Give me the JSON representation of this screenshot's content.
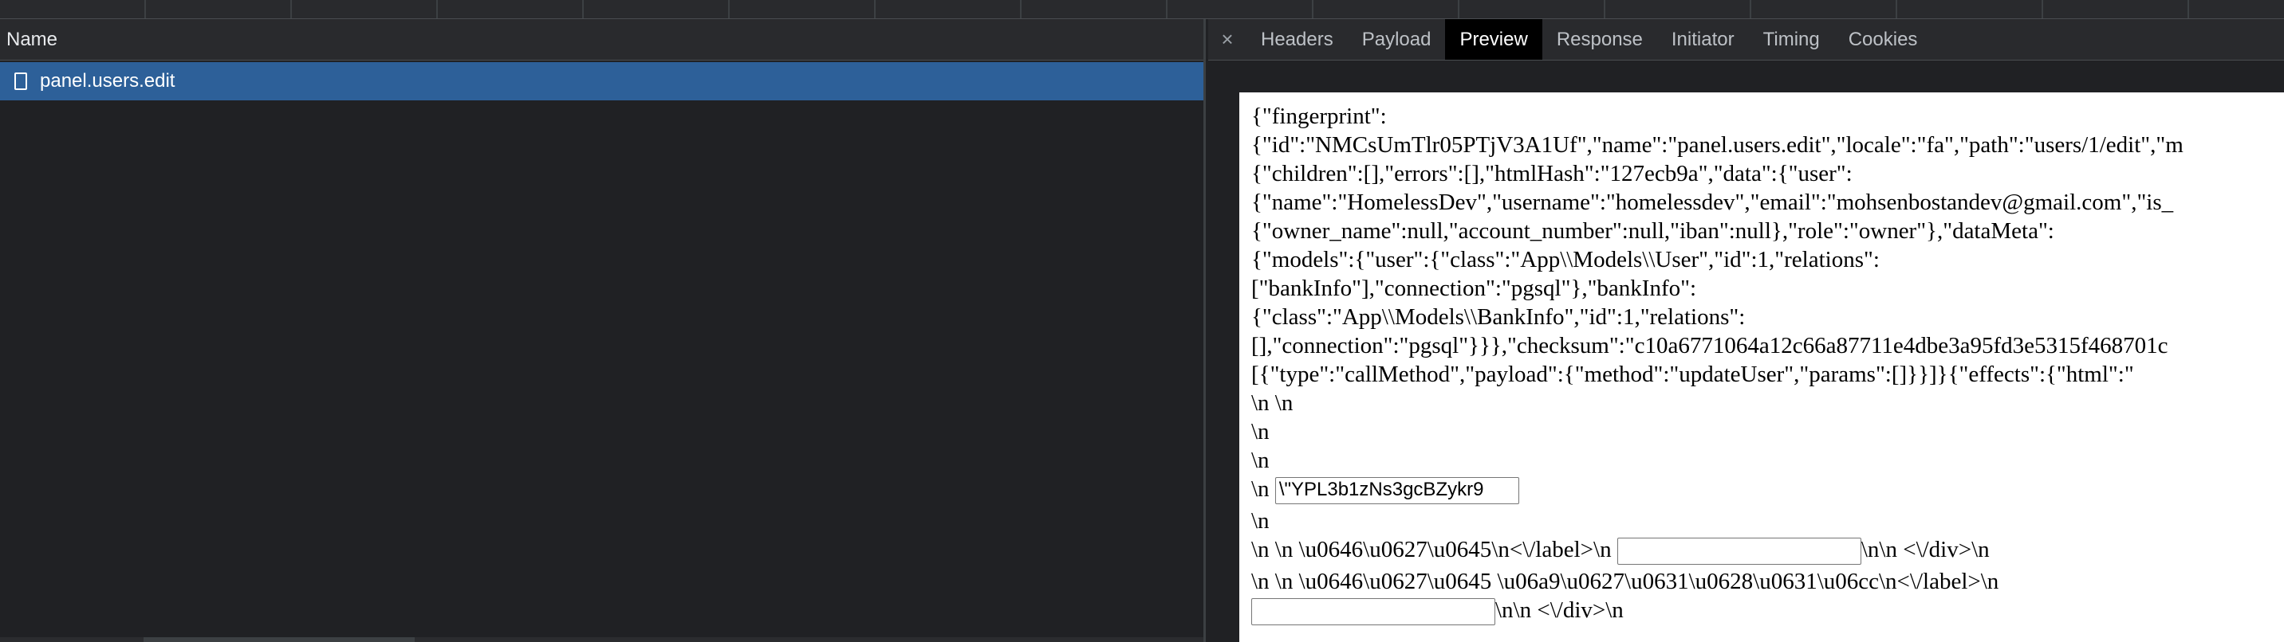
{
  "network": {
    "column_name": "Name",
    "requests": [
      {
        "name": "panel.users.edit",
        "selected": true
      }
    ]
  },
  "details": {
    "tabs": [
      {
        "label": "Headers",
        "active": false
      },
      {
        "label": "Payload",
        "active": false
      },
      {
        "label": "Preview",
        "active": true
      },
      {
        "label": "Response",
        "active": false
      },
      {
        "label": "Initiator",
        "active": false
      },
      {
        "label": "Timing",
        "active": false
      },
      {
        "label": "Cookies",
        "active": false
      }
    ],
    "close_glyph": "×"
  },
  "preview": {
    "lines": [
      "{\"fingerprint\":",
      "{\"id\":\"NMCsUmTlr05PTjV3A1Uf\",\"name\":\"panel.users.edit\",\"locale\":\"fa\",\"path\":\"users/1/edit\",\"m",
      "{\"children\":[],\"errors\":[],\"htmlHash\":\"127ecb9a\",\"data\":{\"user\":",
      "{\"name\":\"HomelessDev\",\"username\":\"homelessdev\",\"email\":\"mohsenbostandev@gmail.com\",\"is_",
      "{\"owner_name\":null,\"account_number\":null,\"iban\":null},\"role\":\"owner\"},\"dataMeta\":",
      "{\"models\":{\"user\":{\"class\":\"App\\\\Models\\\\User\",\"id\":1,\"relations\":",
      "[\"bankInfo\"],\"connection\":\"pgsql\"},\"bankInfo\":",
      "{\"class\":\"App\\\\Models\\\\BankInfo\",\"id\":1,\"relations\":",
      "[],\"connection\":\"pgsql\"}}},\"checksum\":\"c10a6771064a12c66a87711e4dbe3a95fd3e5315f468701c",
      "[{\"type\":\"callMethod\",\"payload\":{\"method\":\"updateUser\",\"params\":[]}}]}{\"effects\":{\"html\":\"",
      "\\n \\n",
      "\\n",
      "\\n"
    ],
    "input_line_prefix": "\\n",
    "token_input_value": "\\\"YPL3b1zNs3gcBZykr9",
    "line_after_input": "\\n",
    "label_line_1_prefix": "\\n \\n \\u0646\\u0627\\u0645\\n<\\/label>\\n",
    "label_line_1_suffix": "\\n\\n <\\/div>\\n",
    "label_line_2": "\\n \\n \\u0646\\u0627\\u0645 \\u06a9\\u0627\\u0631\\u0628\\u0631\\u06cc\\n<\\/label>\\n",
    "last_line_suffix": "\\n\\n <\\/div>\\n"
  },
  "colors": {
    "selection": "#2d6099",
    "panel_bg": "#202124",
    "header_bg": "#292a2d",
    "active_tab_bg": "#000000",
    "preview_bg": "#ffffff"
  }
}
